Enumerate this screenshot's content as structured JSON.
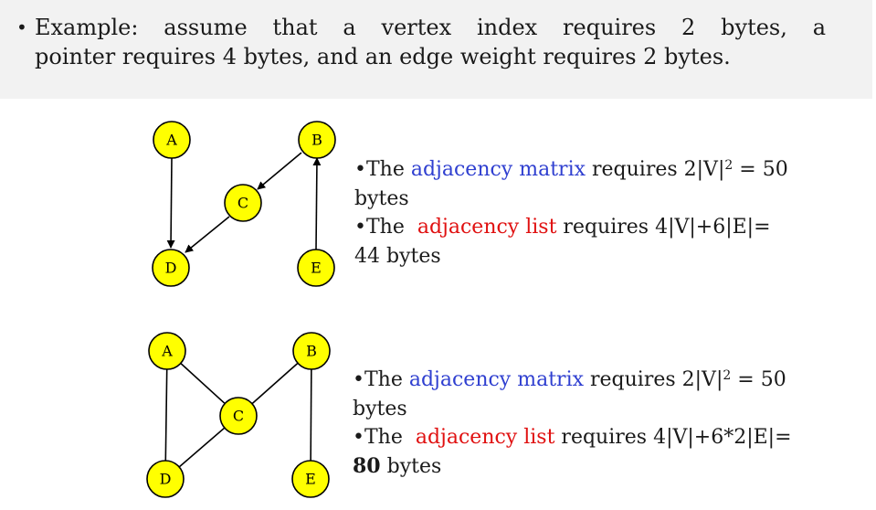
{
  "header": {
    "bullet": "•",
    "line1": "Example: assume that a vertex index requires 2 bytes, a",
    "line2": "pointer requires 4 bytes, and an edge weight requires 2 bytes."
  },
  "graph1": {
    "nodes": {
      "A": "A",
      "B": "B",
      "C": "C",
      "D": "D",
      "E": "E"
    },
    "info": {
      "bullet": "•",
      "the": "The ",
      "matrix_term": "adjacency matrix",
      "matrix_req": " requires 2|V|",
      "sup": "2",
      "matrix_eq": " = 50",
      "matrix_unit": "bytes",
      "the2": "The  ",
      "list_term": "adjacency list",
      "list_req": " requires 4|V|+6|E|=",
      "list_value": "44",
      "list_unit": " bytes"
    }
  },
  "graph2": {
    "nodes": {
      "A": "A",
      "B": "B",
      "C": "C",
      "D": "D",
      "E": "E"
    },
    "info": {
      "bullet": "•",
      "the": "The ",
      "matrix_term": "adjacency matrix",
      "matrix_req": " requires 2|V|",
      "sup": "2",
      "matrix_eq": " = 50",
      "matrix_unit": "bytes",
      "the2": "The  ",
      "list_term": "adjacency list",
      "list_req": " requires 4|V|+6*2|E|=",
      "list_value": "80",
      "list_unit": " bytes"
    }
  },
  "colors": {
    "node_fill": "#ffff00",
    "term_blue": "#2f3fd0",
    "term_red": "#e01010",
    "header_bg": "#f2f2f2"
  }
}
